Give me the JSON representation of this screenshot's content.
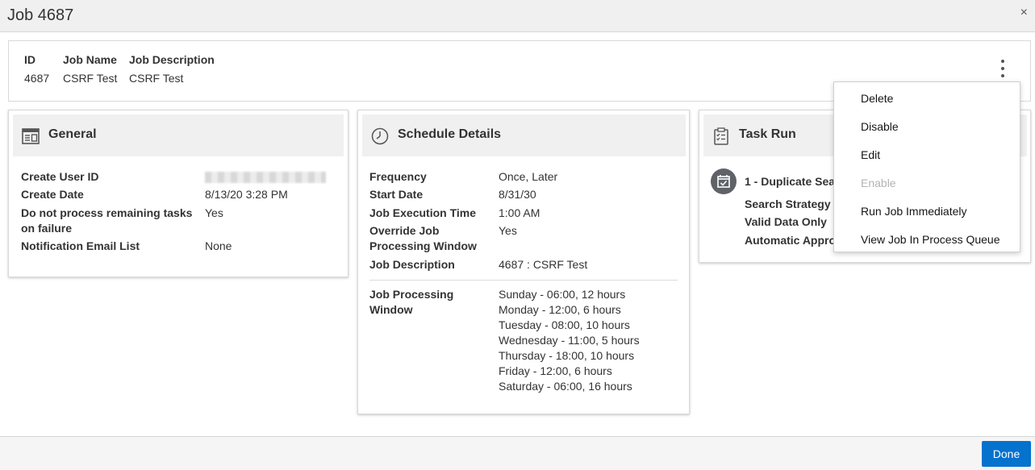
{
  "dialog": {
    "title": "Job 4687",
    "close_symbol": "×"
  },
  "job_header": {
    "id_label": "ID",
    "id_value": "4687",
    "name_label": "Job Name",
    "name_value": "CSRF Test",
    "desc_label": "Job Description",
    "desc_value": "CSRF Test"
  },
  "general": {
    "title": "General",
    "icon": "panel-icon",
    "rows": [
      {
        "label": "Create User ID",
        "value": ""
      },
      {
        "label": "Create Date",
        "value": "8/13/20 3:28 PM"
      },
      {
        "label": "Do not process remaining tasks on failure",
        "value": "Yes"
      },
      {
        "label": "Notification Email List",
        "value": "None"
      }
    ]
  },
  "schedule": {
    "title": "Schedule Details",
    "icon": "clock-icon",
    "rows": [
      {
        "label": "Frequency",
        "value": "Once, Later"
      },
      {
        "label": "Start Date",
        "value": "8/31/30"
      },
      {
        "label": "Job Execution Time",
        "value": "1:00 AM"
      },
      {
        "label": "Override Job Processing Window",
        "value": "Yes"
      },
      {
        "label": "Job Description",
        "value": "4687 : CSRF Test"
      }
    ],
    "window_label": "Job Processing Window",
    "window_lines": [
      "Sunday - 06:00, 12 hours",
      "Monday - 12:00, 6 hours",
      "Tuesday - 08:00, 10 hours",
      "Wednesday - 11:00, 5 hours",
      "Thursday - 18:00, 10 hours",
      "Friday - 12:00, 6 hours",
      "Saturday - 06:00, 16 hours"
    ]
  },
  "task_run": {
    "title": "Task Run",
    "icon": "clipboard-icon",
    "task_title": "1 - Duplicate Sea",
    "rows": [
      "Search Strategy",
      "Valid Data Only",
      "Automatic Appro"
    ]
  },
  "actions_menu": {
    "items": [
      {
        "label": "Delete",
        "enabled": true
      },
      {
        "label": "Disable",
        "enabled": true
      },
      {
        "label": "Edit",
        "enabled": true
      },
      {
        "label": "Enable",
        "enabled": false
      },
      {
        "label": "Run Job Immediately",
        "enabled": true
      },
      {
        "label": "View Job In Process Queue",
        "enabled": true
      }
    ]
  },
  "footer": {
    "done_label": "Done"
  },
  "colors": {
    "accent": "#0572ce",
    "header_bg": "#f1f0f0",
    "disabled_text": "#b3b3b3"
  }
}
